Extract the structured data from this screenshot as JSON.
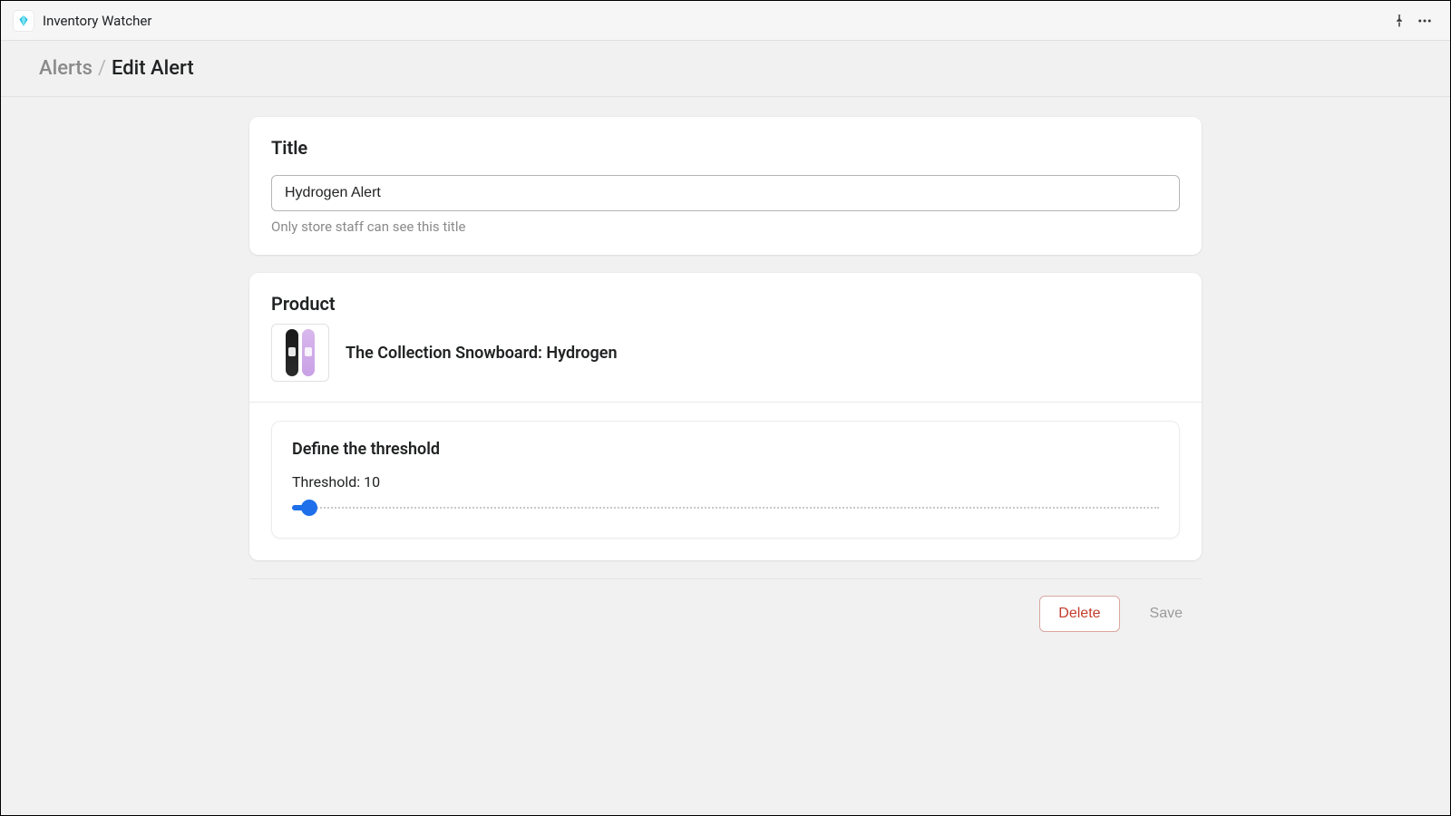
{
  "app": {
    "name": "Inventory Watcher"
  },
  "breadcrumb": {
    "parent": "Alerts",
    "separator": "/",
    "current": "Edit Alert"
  },
  "title_card": {
    "heading": "Title",
    "value": "Hydrogen Alert",
    "help": "Only store staff can see this title"
  },
  "product_card": {
    "heading": "Product",
    "product_name": "The Collection Snowboard: Hydrogen"
  },
  "threshold_card": {
    "heading": "Define the threshold",
    "label_prefix": "Threshold: ",
    "value": 10,
    "min": 0,
    "max": 500
  },
  "actions": {
    "delete": "Delete",
    "save": "Save"
  }
}
